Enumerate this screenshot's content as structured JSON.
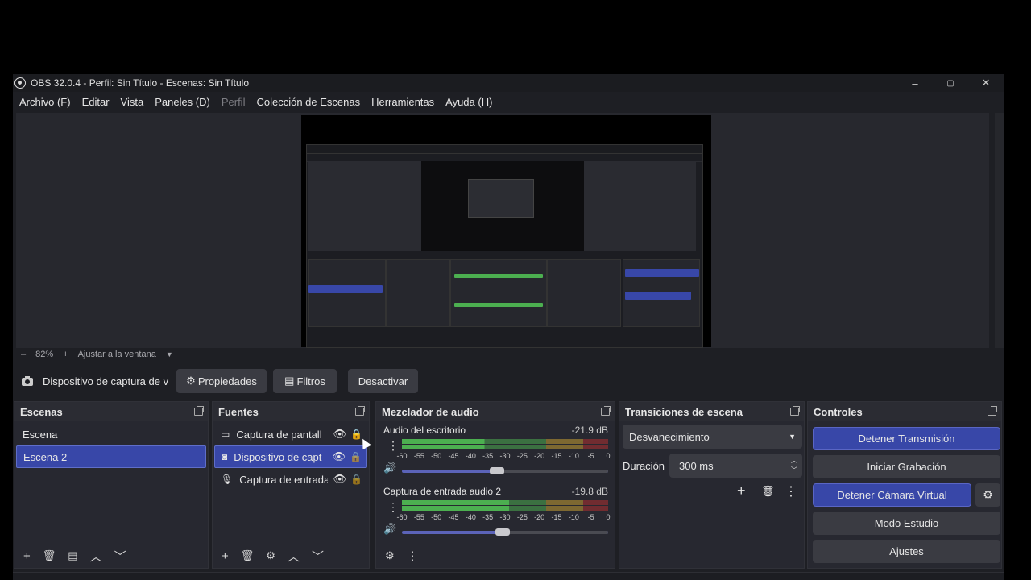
{
  "window": {
    "title": "OBS 32.0.4 - Perfil: Sin Título - Escenas: Sin Título",
    "minimize": "–",
    "maximize": "▢",
    "close": "✕"
  },
  "menu": {
    "items": [
      "Archivo (F)",
      "Editar",
      "Vista",
      "Paneles (D)",
      "Perfil",
      "Colección de Escenas",
      "Herramientas",
      "Ayuda (H)"
    ]
  },
  "zoom": {
    "minus": "–",
    "value": "82%",
    "plus": "+",
    "fit": "Ajustar a la ventana",
    "dropdown": "▼"
  },
  "source_toolbar": {
    "selected_source": "Dispositivo de captura de v",
    "properties": "Propiedades",
    "filters": "Filtros",
    "deactivate": "Desactivar"
  },
  "scenes": {
    "title": "Escenas",
    "items": [
      "Escena",
      "Escena 2"
    ],
    "selected_index": 1
  },
  "sources": {
    "title": "Fuentes",
    "items": [
      {
        "label": "Captura de pantall",
        "icon": "monitor-icon"
      },
      {
        "label": "Dispositivo de capt",
        "icon": "camera-icon"
      },
      {
        "label": "Captura de entrada",
        "icon": "microphone-icon"
      }
    ],
    "selected_index": 1
  },
  "mixer": {
    "title": "Mezclador de audio",
    "channels": [
      {
        "name": "Audio del escritorio",
        "db": "-21.9 dB",
        "level": 0.4,
        "volume": 0.46
      },
      {
        "name": "Captura de entrada audio 2",
        "db": "-19.8 dB",
        "level": 0.52,
        "volume": 0.49
      }
    ],
    "scale": [
      "-60",
      "-55",
      "-50",
      "-45",
      "-40",
      "-35",
      "-30",
      "-25",
      "-20",
      "-15",
      "-10",
      "-5",
      "0"
    ]
  },
  "transitions": {
    "title": "Transiciones de escena",
    "selected": "Desvanecimiento",
    "duration_label": "Duración",
    "duration_value": "300 ms"
  },
  "controls": {
    "title": "Controles",
    "stop_stream": "Detener Transmisión",
    "start_record": "Iniciar Grabación",
    "stop_vcam": "Detener Cámara Virtual",
    "studio_mode": "Modo Estudio",
    "settings": "Ajustes"
  },
  "colors": {
    "accent": "#3847a8",
    "panel": "#272830",
    "background": "#1e1f24",
    "meter_green": "#4caf50",
    "meter_yellow": "#c8a032",
    "meter_red": "#b23030"
  }
}
